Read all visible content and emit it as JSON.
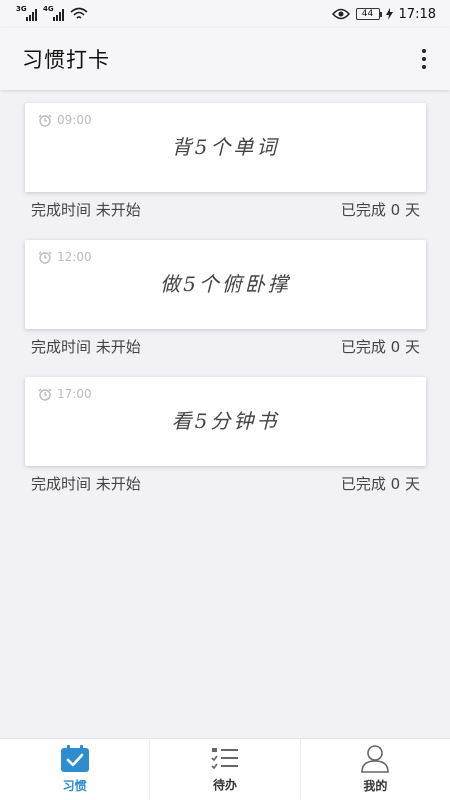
{
  "status_bar": {
    "network1": "3G",
    "network2": "4G",
    "battery": "44",
    "time": "17:18"
  },
  "app_bar": {
    "title": "习惯打卡"
  },
  "habits": [
    {
      "time": "09:00",
      "title": "背5个单词",
      "completion_time": "完成时间 未开始",
      "completed_days": "已完成 0 天"
    },
    {
      "time": "12:00",
      "title": "做5个俯卧撑",
      "completion_time": "完成时间 未开始",
      "completed_days": "已完成 0 天"
    },
    {
      "time": "17:00",
      "title": "看5分钟书",
      "completion_time": "完成时间 未开始",
      "completed_days": "已完成 0 天"
    }
  ],
  "bottom_nav": {
    "items": [
      {
        "label": "习惯",
        "icon": "calendar-check-icon",
        "active": true
      },
      {
        "label": "待办",
        "icon": "checklist-icon",
        "active": false
      },
      {
        "label": "我的",
        "icon": "person-icon",
        "active": false
      }
    ]
  },
  "colors": {
    "accent": "#2e8ccf",
    "background": "#f2f1f6"
  }
}
